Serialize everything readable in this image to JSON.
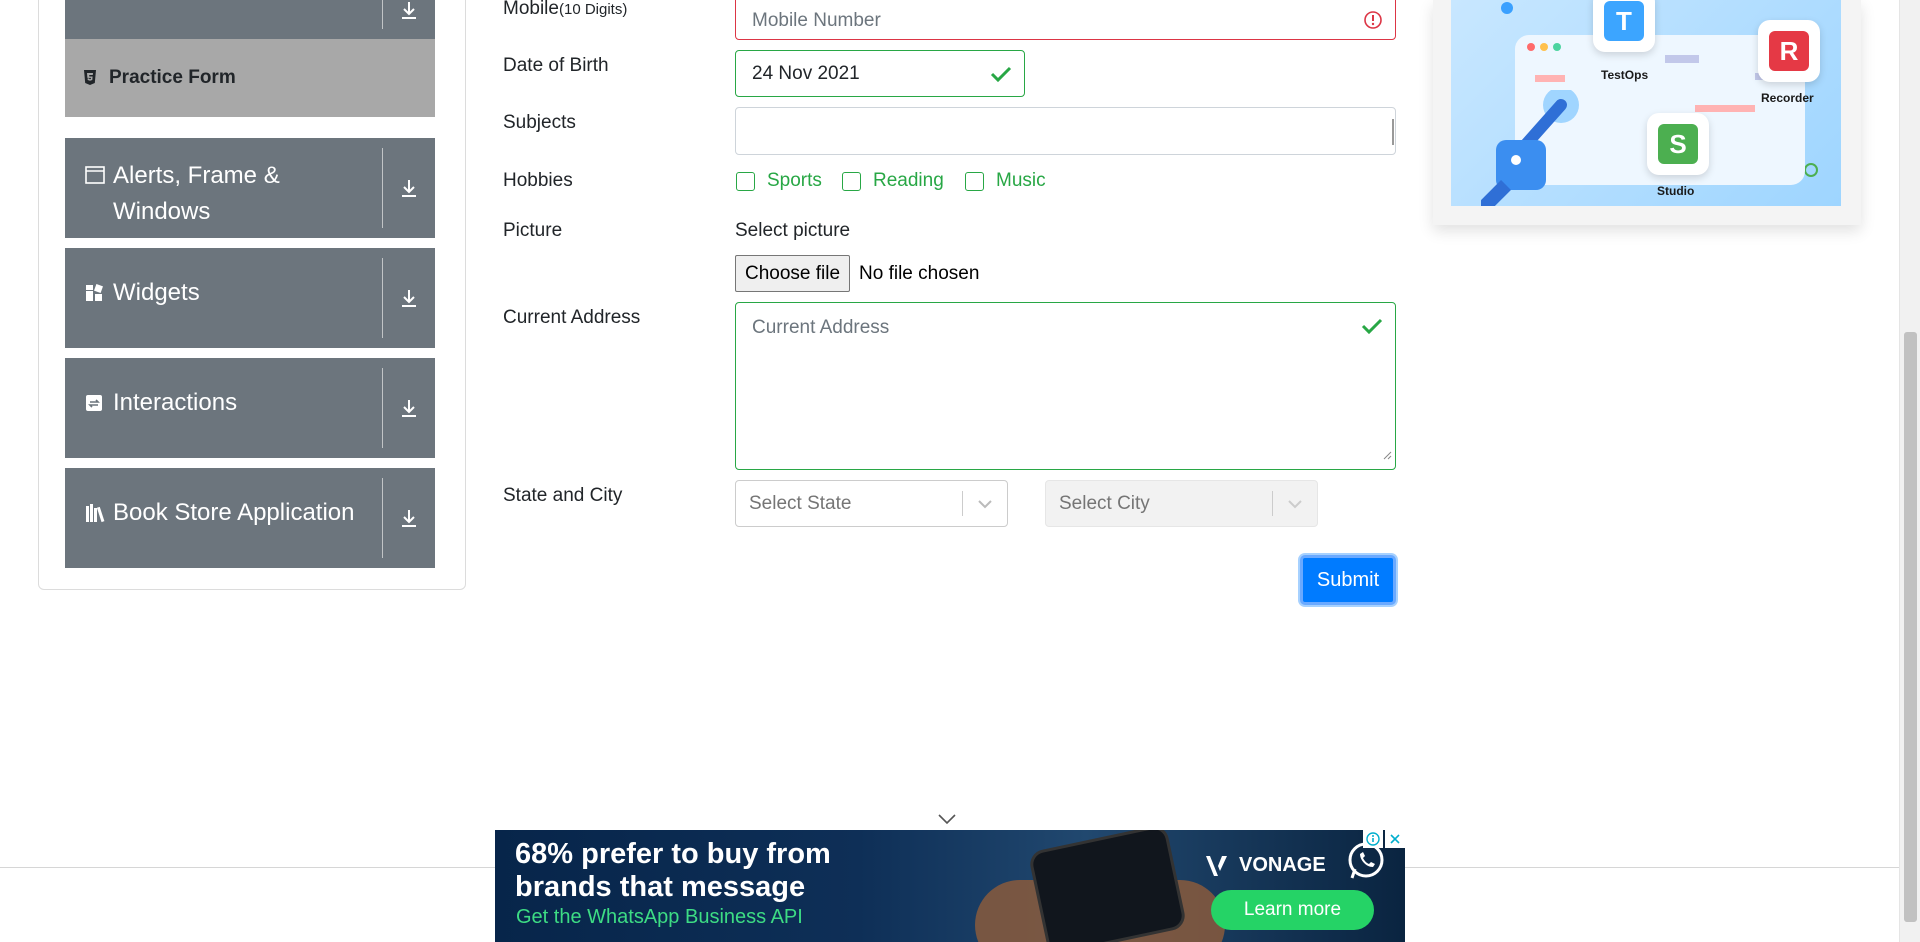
{
  "sidebar": {
    "active_item": "Practice Form",
    "groups": [
      {
        "label": "Alerts, Frame & Windows",
        "icon": "window-icon"
      },
      {
        "label": "Widgets",
        "icon": "widgets-icon"
      },
      {
        "label": "Interactions",
        "icon": "interactions-icon"
      },
      {
        "label": "Book Store Application",
        "icon": "books-icon"
      }
    ]
  },
  "form": {
    "mobile_label": "Mobile",
    "mobile_hint": "(10 Digits)",
    "mobile_placeholder": "Mobile Number",
    "dob_label": "Date of Birth",
    "dob_value": "24 Nov 2021",
    "subjects_label": "Subjects",
    "hobbies_label": "Hobbies",
    "hobbies": [
      "Sports",
      "Reading",
      "Music"
    ],
    "picture_label": "Picture",
    "select_picture": "Select picture",
    "choose_file": "Choose file",
    "no_file": "No file chosen",
    "address_label": "Current Address",
    "address_placeholder": "Current Address",
    "state_city_label": "State and City",
    "state_placeholder": "Select State",
    "city_placeholder": "Select City",
    "submit": "Submit"
  },
  "promo": {
    "tiles": [
      "TestOps",
      "Recorder",
      "Studio"
    ],
    "tile_letters": [
      "T",
      "R",
      "S"
    ]
  },
  "ad": {
    "headline": "68% prefer to buy from brands that message",
    "sub": "Get the WhatsApp Business API",
    "brand": "VONAGE",
    "cta": "Learn more"
  },
  "colors": {
    "sidebar_group": "#6c757d",
    "active_item": "#a8a8a8",
    "valid": "#28a745",
    "invalid": "#dc3545",
    "primary": "#007bff"
  }
}
